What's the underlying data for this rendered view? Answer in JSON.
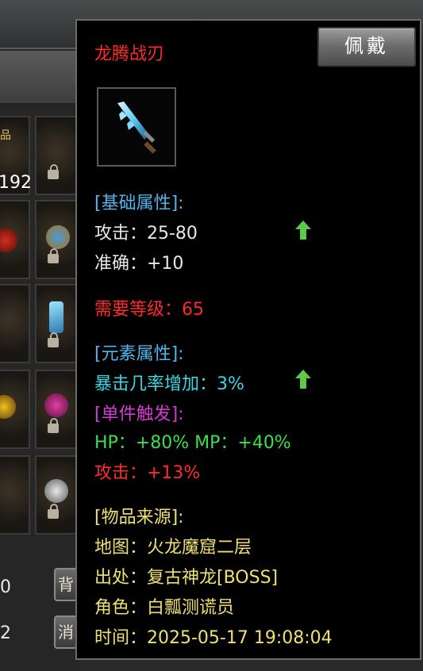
{
  "background": {
    "slot_count": "192",
    "slot_tag": "品",
    "bottom_btn_1": "背",
    "bottom_btn_2": "消",
    "bottom_num_1": "0",
    "bottom_num_2": "2"
  },
  "item": {
    "name": "龙腾战刃",
    "equip_label": "佩戴",
    "icon": "blue-blade-icon"
  },
  "base_attrs": {
    "header": "[基础属性]:",
    "attack": "攻击：25-80",
    "accuracy": "准确：+10"
  },
  "required_level": "需要等级：65",
  "element_attrs": {
    "header": "[元素属性]:",
    "crit": "暴击几率增加：3%"
  },
  "set_trigger": {
    "header": "[单件触发]:",
    "hp_mp": " HP：+80%    MP：+40%",
    "attack": "攻击：+13%"
  },
  "source": {
    "header": "[物品来源]:",
    "map": "地图：火龙魔窟二层",
    "origin": "出处：复古神龙[BOSS]",
    "role": "角色：白瓢测谎员",
    "time": "时间：2025-05-17 19:08:04"
  },
  "colors": {
    "name": "#ff2a2a",
    "header_blue": "#4fb6f0",
    "cyan": "#3ad6e6",
    "magenta": "#d63ad6",
    "green": "#3ae04a",
    "yellow": "#f0e070",
    "arrow": "#5ec84a"
  }
}
